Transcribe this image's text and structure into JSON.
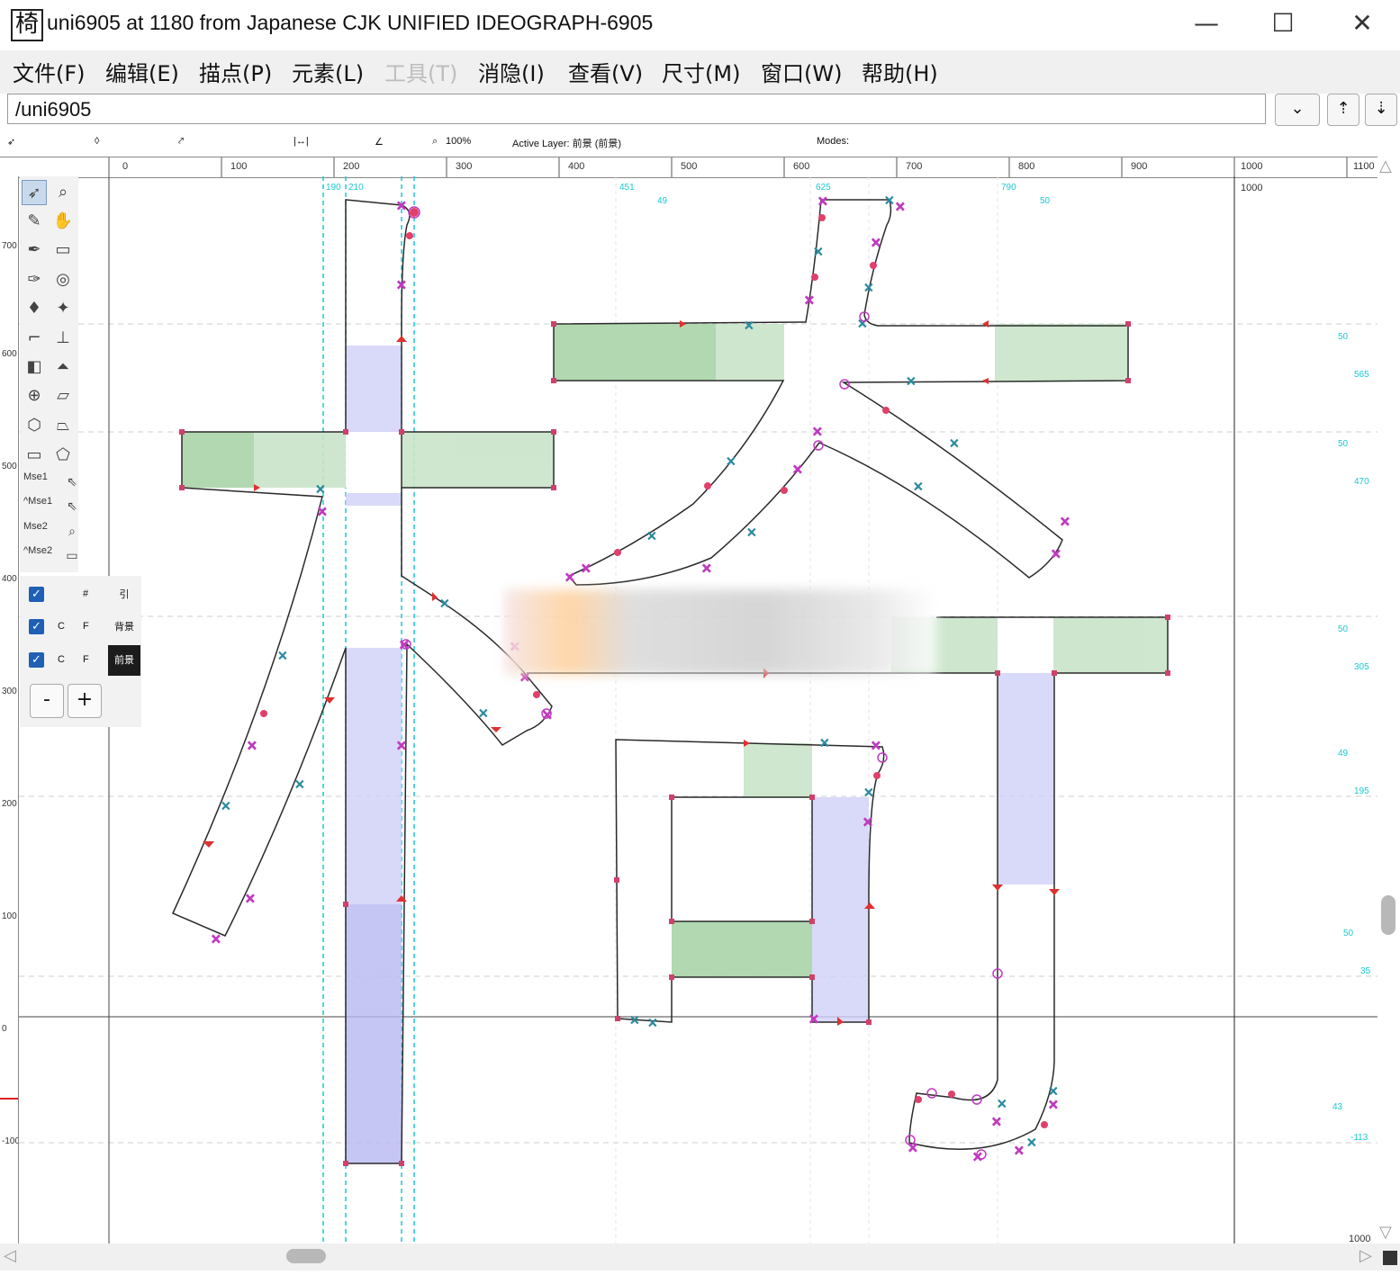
{
  "window": {
    "icon_char": "椅",
    "title": "uni6905 at 1180 from Japanese CJK UNIFIED IDEOGRAPH-6905",
    "minimize": "—",
    "maximize": "☐",
    "close": "✕"
  },
  "menu": [
    {
      "label": "文件(F)",
      "enabled": true
    },
    {
      "label": "编辑(E)",
      "enabled": true
    },
    {
      "label": "描点(P)",
      "enabled": true
    },
    {
      "label": "元素(L)",
      "enabled": true
    },
    {
      "label": "工具(T)",
      "enabled": false
    },
    {
      "label": "消隐(I)",
      "enabled": true
    },
    {
      "label": "查看(V)",
      "enabled": true
    },
    {
      "label": "尺寸(M)",
      "enabled": true
    },
    {
      "label": "窗口(W)",
      "enabled": true
    },
    {
      "label": "帮助(H)",
      "enabled": true
    }
  ],
  "glyph_field": {
    "value": "/uni6905"
  },
  "toolbar_buttons": {
    "dropdown": "⌄",
    "prev": "⇡",
    "next": "⇣"
  },
  "infobar": {
    "zoom": "100%",
    "active_layer": "Active Layer: 前景 (前景)",
    "modes": "Modes:"
  },
  "ruler_top_labels": [
    "0",
    "100",
    "200",
    "300",
    "400",
    "500",
    "600",
    "700",
    "800",
    "900",
    "1000",
    "1100"
  ],
  "ruler_left_labels": [
    "700",
    "600",
    "500",
    "400",
    "300",
    "200",
    "100",
    "0",
    "-100"
  ],
  "tools": {
    "mouse_labels": [
      "Mse1",
      "^Mse1",
      "Mse2",
      "^Mse2"
    ]
  },
  "layers": [
    {
      "checked": true,
      "c": "",
      "f": "#",
      "name": "引",
      "active": false
    },
    {
      "checked": true,
      "c": "C",
      "f": "F",
      "name": "背景",
      "active": false
    },
    {
      "checked": true,
      "c": "C",
      "f": "F",
      "name": "前景",
      "active": true
    }
  ],
  "layer_buttons": {
    "remove": "-",
    "add": "+"
  },
  "canvas_labels": {
    "top": [
      "190",
      "210",
      "451",
      "49",
      "625",
      "790",
      "50",
      "1000"
    ],
    "right": [
      "50",
      "565",
      "50",
      "470",
      "50",
      "305",
      "49",
      "195",
      "50",
      "35",
      "43",
      "-113",
      "1000"
    ]
  },
  "colors": {
    "accent_blue": "#1f5fb4",
    "stem_fill": "#cfcff7",
    "counter_fill": "#c9e4c9",
    "curve_point": "#c8186e",
    "guide": "#19c9d1"
  }
}
